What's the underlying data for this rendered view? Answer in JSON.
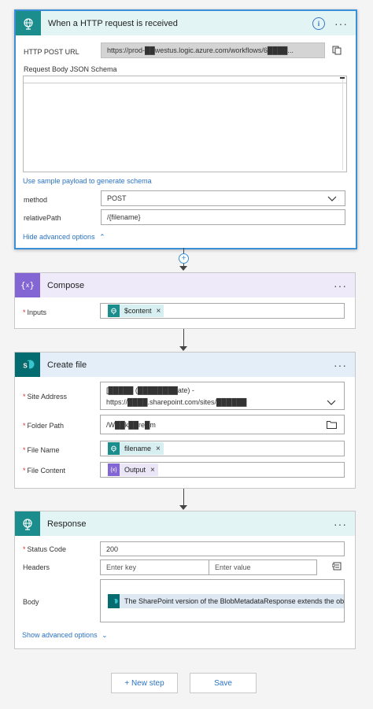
{
  "trigger": {
    "title": "When a HTTP request is received",
    "url_label": "HTTP POST URL",
    "url_value": "https://prod-██westus.logic.azure.com/workflows/6████...",
    "schema_label": "Request Body JSON Schema",
    "sample_link": "Use sample payload to generate schema",
    "method_label": "method",
    "method_value": "POST",
    "relpath_label": "relativePath",
    "relpath_value": "/{filename}",
    "hide_advanced": "Hide advanced options"
  },
  "compose": {
    "title": "Compose",
    "inputs_label": "Inputs",
    "inputs_token": "$content"
  },
  "create_file": {
    "title": "Create file",
    "site_label": "Site Address",
    "site_line1": "[█████ (████████ate) -",
    "site_line2": "https://████.sharepoint.com/sites/██████",
    "folder_label": "Folder Path",
    "folder_value": "/W██k██re█m",
    "filename_label": "File Name",
    "filename_token": "filename",
    "content_label": "File Content",
    "content_token": "Output"
  },
  "response": {
    "title": "Response",
    "status_label": "Status Code",
    "status_value": "200",
    "headers_label": "Headers",
    "key_placeholder": "Enter key",
    "value_placeholder": "Enter value",
    "body_label": "Body",
    "body_value": "The SharePoint version of the BlobMetadataResponse extends the object",
    "show_advanced": "Show advanced options"
  },
  "actions": {
    "new_step": "+ New step",
    "save": "Save"
  },
  "colors": {
    "accent": "#3b8fd6",
    "teal": "#1a8d8c",
    "purple": "#8465d4",
    "sharepoint": "#036c70"
  }
}
